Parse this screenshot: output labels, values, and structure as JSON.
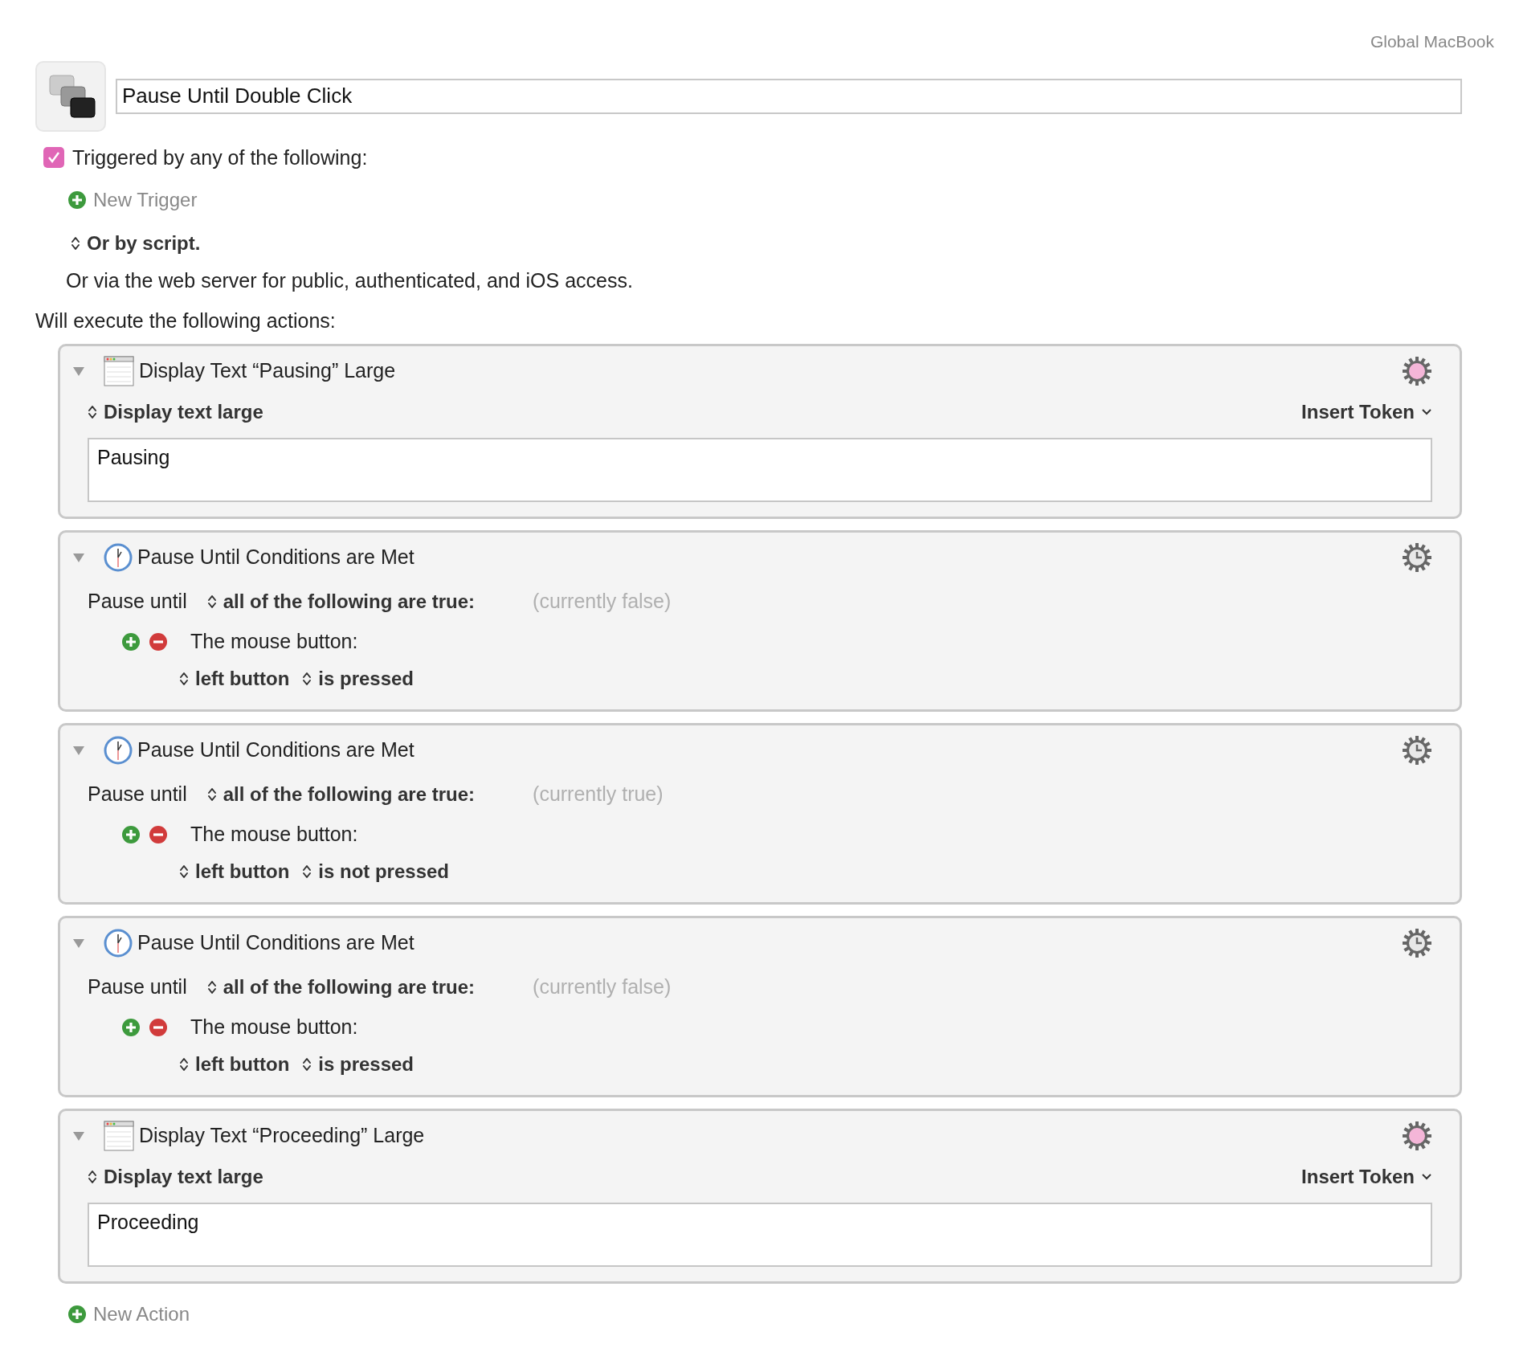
{
  "header": {
    "scope": "Global MacBook",
    "macro_name": "Pause Until Double Click"
  },
  "triggers": {
    "enabled_label": "Triggered by any of the following:",
    "checked": true,
    "new_trigger": "New Trigger",
    "script_label": "Or by script.",
    "web_server_note": "Or via the web server for public, authenticated, and iOS access."
  },
  "actions_heading": "Will execute the following actions:",
  "actions": [
    {
      "kind": "display_text",
      "expanded": true,
      "title": "Display Text “Pausing” Large",
      "mode": "Display text large",
      "insert_token": "Insert Token",
      "text": "Pausing"
    },
    {
      "kind": "pause_until",
      "expanded": true,
      "title": "Pause Until Conditions are Met",
      "label": "Pause until",
      "mode": "all of the following are true:",
      "status": "(currently false)",
      "condition": "The mouse button:",
      "button": "left button",
      "state": "is pressed"
    },
    {
      "kind": "pause_until",
      "expanded": true,
      "title": "Pause Until Conditions are Met",
      "label": "Pause until",
      "mode": "all of the following are true:",
      "status": "(currently true)",
      "condition": "The mouse button:",
      "button": "left button",
      "state": "is not pressed"
    },
    {
      "kind": "pause_until",
      "expanded": true,
      "title": "Pause Until Conditions are Met",
      "label": "Pause until",
      "mode": "all of the following are true:",
      "status": "(currently false)",
      "condition": "The mouse button:",
      "button": "left button",
      "state": "is pressed"
    },
    {
      "kind": "display_text",
      "expanded": true,
      "title": "Display Text “Proceeding” Large",
      "mode": "Display text large",
      "insert_token": "Insert Token",
      "text": "Proceeding"
    }
  ],
  "new_action": "New Action"
}
